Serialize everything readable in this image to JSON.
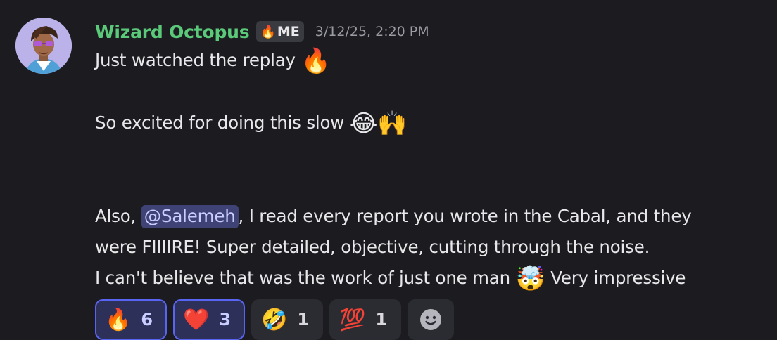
{
  "message": {
    "author": "Wizard Octopus",
    "tag": {
      "icon": "🔥",
      "label": "ME"
    },
    "timestamp": "3/12/25, 2:20 PM",
    "lines": {
      "l1_text": "Just watched the replay",
      "l1_emoji": "🔥",
      "l2_text": "So excited for doing this slow",
      "l2_emoji": "😂🙌",
      "l3_pre": "Also, ",
      "mention": "@Salemeh",
      "l3_post": ", I read every report you wrote in the Cabal, and they",
      "l4": "were FIIIIRE! Super detailed, objective, cutting through the noise.",
      "l5_text": "I can't believe that was the work of just one man",
      "l5_emoji": "🤯",
      "l5_post": "Very impressive"
    }
  },
  "reactions": [
    {
      "emoji": "🔥",
      "count": "6",
      "active": true,
      "icon": "fire-icon"
    },
    {
      "emoji": "❤️",
      "count": "3",
      "active": true,
      "icon": "heart-icon"
    },
    {
      "emoji": "🤣",
      "count": "1",
      "active": false,
      "icon": "rofl-icon"
    },
    {
      "emoji": "💯",
      "count": "1",
      "active": false,
      "icon": "hundred-icon"
    }
  ],
  "add_reaction_icon": "smiley-add-icon",
  "colors": {
    "background": "#1c1c20",
    "username": "#5bc97a",
    "mention_bg": "#3f4275",
    "reaction_active_border": "#5865f2"
  }
}
